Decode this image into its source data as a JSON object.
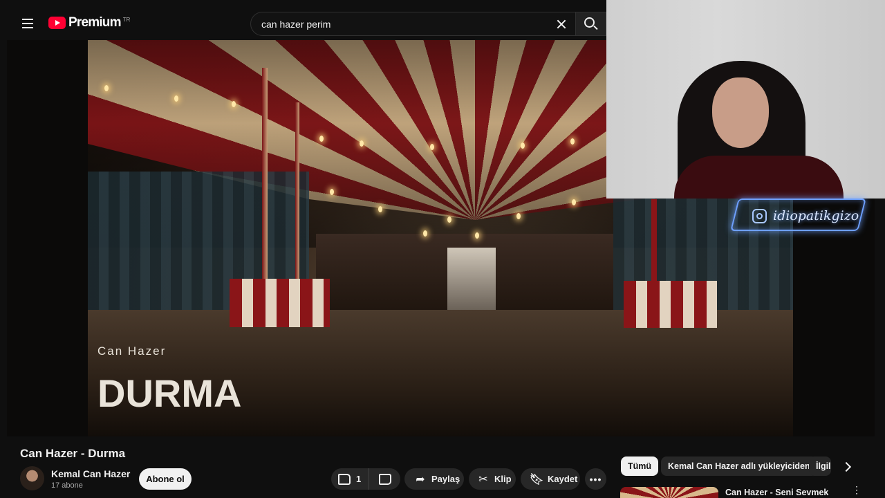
{
  "header": {
    "logo_text": "Premium",
    "region": "TR",
    "search_value": "can hazer perim"
  },
  "video": {
    "artist_overlay": "Can Hazer",
    "title_overlay": "DURMA",
    "watermark": "idiopatikgizo"
  },
  "details": {
    "title": "Can Hazer - Durma",
    "channel_name": "Kemal Can Hazer",
    "subscribers": "17 abone",
    "subscribe_label": "Abone ol",
    "like_count": "1",
    "share_label": "Paylaş",
    "clip_label": "Klip",
    "save_label": "Kaydet",
    "more_label": "•••"
  },
  "sidebar": {
    "chips": [
      "Tümü",
      "Kemal Can Hazer adlı yükleyiciden",
      "İlgili"
    ],
    "recommendation": {
      "title": "Can Hazer - Seni Sevmek",
      "menu": "⋮"
    }
  },
  "colors": {
    "background": "#0f0f0f",
    "brand_red": "#ff0033",
    "pill": "#272727",
    "watermark_glow": "#6ea0ff"
  }
}
